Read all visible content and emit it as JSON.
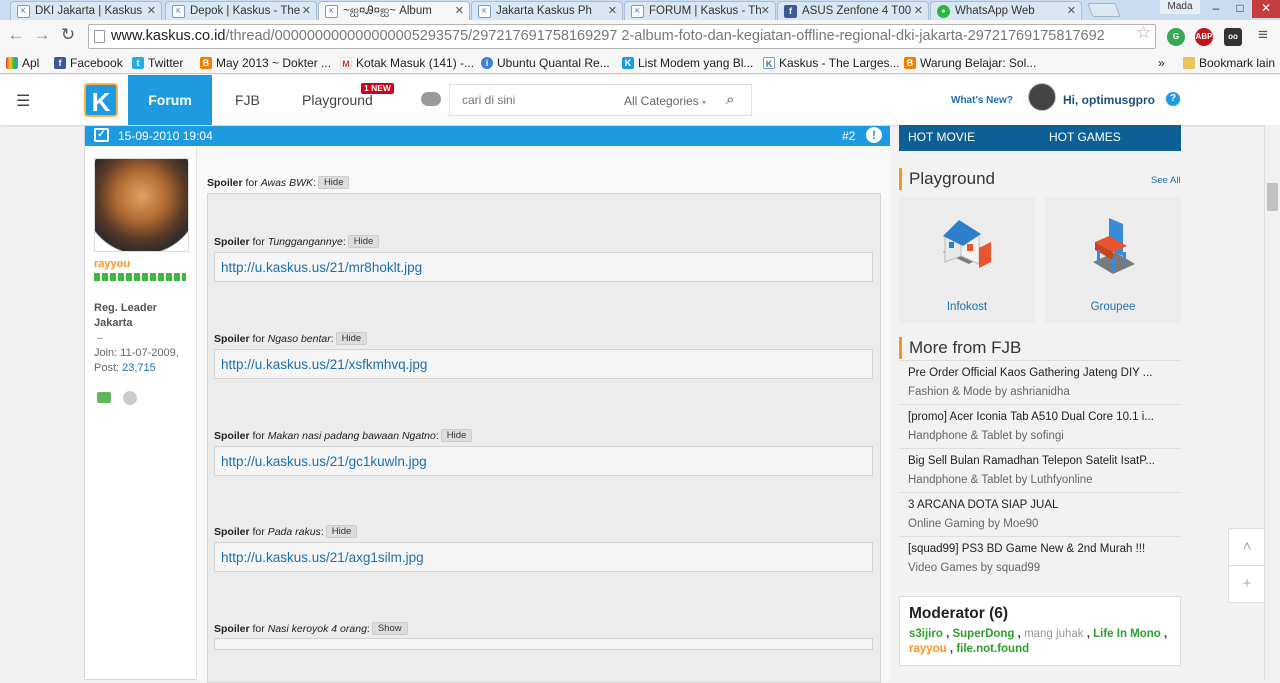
{
  "browser": {
    "tabs": [
      {
        "title": "DKI Jakarta | Kaskus",
        "icon": "kaskus-favicon"
      },
      {
        "title": "Depok | Kaskus - The",
        "icon": "kaskus-favicon"
      },
      {
        "title": "~ஐ¤Ꭿ¤ஐ~ Album",
        "icon": "kaskus-favicon"
      },
      {
        "title": "Jakarta Kaskus Ph",
        "icon": "kaskus-favicon"
      },
      {
        "title": "FORUM | Kaskus - Th",
        "icon": "kaskus-favicon"
      },
      {
        "title": "ASUS Zenfone 4 T00",
        "icon": "facebook-favicon"
      },
      {
        "title": "WhatsApp Web",
        "icon": "whatsapp-favicon"
      }
    ],
    "profile_label": "Mada",
    "url_host": "www.kaskus.co.id",
    "url_path": "/thread/000000000000000005293575/297217691758169297 2-album-foto-dan-kegiatan-offline-regional-dki-jakarta-29721769175817692",
    "bookmarks": [
      {
        "label": "Apl",
        "icon": "apps-grid-icon"
      },
      {
        "label": "Facebook",
        "icon": "facebook-icon"
      },
      {
        "label": "Twitter",
        "icon": "twitter-icon"
      },
      {
        "label": "May 2013 ~ Dokter ...",
        "icon": "blogger-icon"
      },
      {
        "label": "Kotak Masuk (141) -...",
        "icon": "gmail-icon"
      },
      {
        "label": "Ubuntu Quantal Re...",
        "icon": "info-icon"
      },
      {
        "label": "List Modem yang Bl...",
        "icon": "kaskus-icon"
      },
      {
        "label": "Kaskus - The Larges...",
        "icon": "kaskus-favicon"
      },
      {
        "label": "Warung Belajar: Sol...",
        "icon": "blogger-icon"
      }
    ],
    "bookmarks_more": "»",
    "bookmarks_folder": "Bookmark lain"
  },
  "header": {
    "logo_text": "K",
    "nav_forum": "Forum",
    "nav_fjb": "FJB",
    "nav_playground": "Playground",
    "new_badge": "1 NEW",
    "search_placeholder": "cari di sini",
    "category_select": "All Categories",
    "whats_new": "What's New?",
    "greeting": "Hi, optimusgpro",
    "help": "?"
  },
  "post": {
    "date": "15-09-2010 19:04",
    "number": "#2",
    "report": "!",
    "user": {
      "name": "rayyou",
      "rank": "Reg. Leader Jakarta",
      "dash": "–",
      "join": "Join: 11-07-2009,",
      "posts_label": "Post: ",
      "posts_value": "23,715"
    },
    "outer_spoiler": {
      "label": "Spoiler",
      "for_text": " for ",
      "title": "Awas BWK",
      "button": "Hide"
    },
    "spoilers": [
      {
        "label": "Spoiler",
        "for_text": " for ",
        "title": "Tunggangannye",
        "button": "Hide",
        "link": "http://u.kaskus.us/21/mr8hoklt.jpg"
      },
      {
        "label": "Spoiler",
        "for_text": " for ",
        "title": "Ngaso bentar",
        "button": "Hide",
        "link": "http://u.kaskus.us/21/xsfkmhvq.jpg"
      },
      {
        "label": "Spoiler",
        "for_text": " for ",
        "title": "Makan nasi padang bawaan Ngatno",
        "button": "Hide",
        "link": "http://u.kaskus.us/21/gc1kuwln.jpg"
      },
      {
        "label": "Spoiler",
        "for_text": " for ",
        "title": "Pada rakus",
        "button": "Hide",
        "link": "http://u.kaskus.us/21/axg1silm.jpg"
      },
      {
        "label": "Spoiler",
        "for_text": " for ",
        "title": "Nasi keroyok 4 orang",
        "button": "Show",
        "link": ""
      }
    ]
  },
  "sidebar": {
    "hot_movie": "HOT MOVIE",
    "hot_games": "HOT GAMES",
    "playground_title": "Playground",
    "see_all": "See All",
    "playground_items": [
      {
        "label": "Infokost",
        "icon": "house-icon"
      },
      {
        "label": "Groupee",
        "icon": "chair-icon"
      }
    ],
    "fjb_title": "More from FJB",
    "fjb_items": [
      {
        "title": "Pre Order Official Kaos Gathering Jateng DIY ...",
        "meta": "Fashion & Mode by ashrianidha"
      },
      {
        "title": "[promo] Acer Iconia Tab A510 Dual Core 10.1 i...",
        "meta": "Handphone & Tablet by sofingi"
      },
      {
        "title": "Big Sell Bulan Ramadhan Telepon Satelit IsatP...",
        "meta": "Handphone & Tablet by Luthfyonline"
      },
      {
        "title": "3 ARCANA DOTA SIAP JUAL",
        "meta": "Online Gaming by Moe90"
      },
      {
        "title": "[squad99] PS3 BD Game New & 2nd Murah !!!",
        "meta": "Video Games by squad99"
      }
    ],
    "moderator_title": "Moderator (6)",
    "moderators": [
      {
        "name": "s3ijiro",
        "style": "g"
      },
      {
        "name": "SuperDong",
        "style": "g"
      },
      {
        "name": "mang juhak",
        "style": "n"
      },
      {
        "name": "Life In Mono",
        "style": "g"
      },
      {
        "name": "rayyou",
        "style": "o"
      },
      {
        "name": "file.not.found",
        "style": "g"
      }
    ]
  },
  "floating": {
    "scroll_top": "˄",
    "add": "+"
  }
}
